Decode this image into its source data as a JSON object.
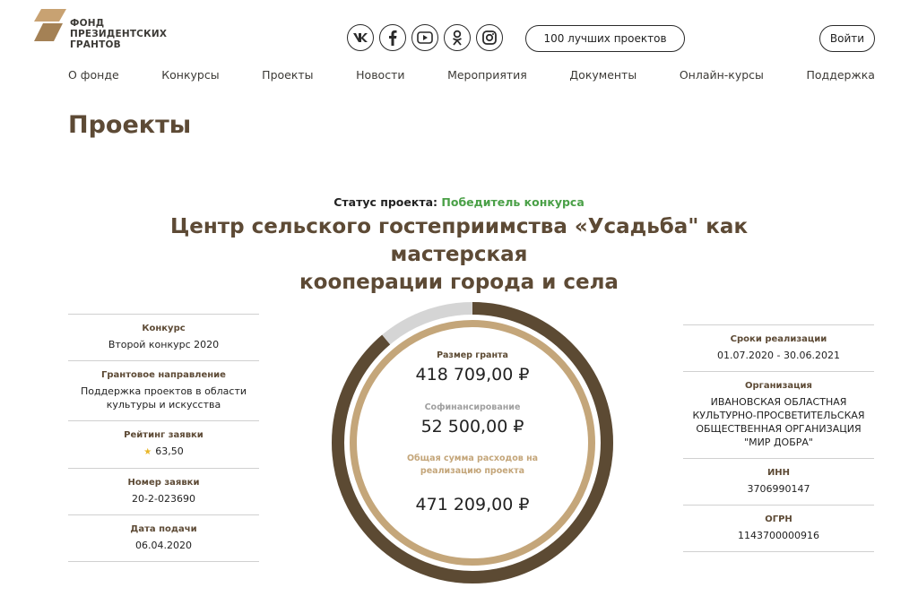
{
  "logo": {
    "lines": [
      "ФОНД",
      "ПРЕЗИДЕНТСКИХ",
      "ГРАНТОВ"
    ]
  },
  "header": {
    "top_projects_label": "100 лучших проектов",
    "login_label": "Войти"
  },
  "socials": [
    "vk-icon",
    "facebook-icon",
    "youtube-icon",
    "odnoklassniki-icon",
    "instagram-icon"
  ],
  "nav": [
    "О фонде",
    "Конкурсы",
    "Проекты",
    "Новости",
    "Мероприятия",
    "Документы",
    "Онлайн-курсы",
    "Поддержка"
  ],
  "page_title": "Проекты",
  "status": {
    "label": "Статус проекта:",
    "value": "Победитель конкурса"
  },
  "project_title_lines": [
    "Центр сельского гостеприимства «Усадьба\" как мастерская",
    "кооперации города и села"
  ],
  "left_info": [
    {
      "label": "Конкурс",
      "value": "Второй конкурс 2020"
    },
    {
      "label": "Грантовое направление",
      "value": "Поддержка проектов в области культуры и искусства"
    },
    {
      "label": "Рейтинг заявки",
      "value": "63,50"
    },
    {
      "label": "Номер заявки",
      "value": "20-2-023690"
    },
    {
      "label": "Дата подачи",
      "value": "06.04.2020"
    }
  ],
  "right_info": [
    {
      "label": "Сроки реализации",
      "value": "01.07.2020 - 30.06.2021"
    },
    {
      "label": "Организация",
      "value": "ИВАНОВСКАЯ ОБЛАСТНАЯ КУЛЬТУРНО-ПРОСВЕТИТЕЛЬСКАЯ ОБЩЕСТВЕННАЯ ОРГАНИЗАЦИЯ \"МИР ДОБРА\""
    },
    {
      "label": "ИНН",
      "value": "3706990147"
    },
    {
      "label": "ОГРН",
      "value": "1143700000916"
    }
  ],
  "finance": {
    "grant_label": "Размер гранта",
    "grant_value": "418 709,00 ₽",
    "cofinancing_label": "Софинансирование",
    "cofinancing_value": "52 500,00 ₽",
    "total_label": "Общая сумма расходов на реализацию проекта",
    "total_value": "471 209,00 ₽",
    "grant_share": 0.8886,
    "colors": {
      "grant": "#5c4a33",
      "cofinancing": "#d5d5d5",
      "total": "#c4a67a",
      "cofinancing_label": "#a0a0a0"
    }
  }
}
